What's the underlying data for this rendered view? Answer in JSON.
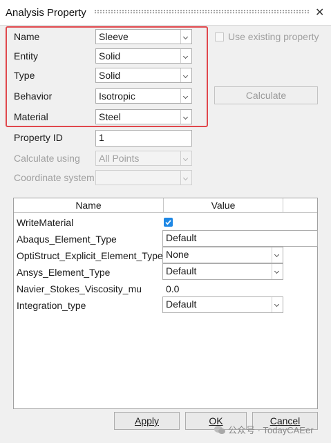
{
  "window": {
    "title": "Analysis Property",
    "close_glyph": "✕"
  },
  "form": {
    "name": {
      "label": "Name",
      "value": "Sleeve"
    },
    "entity": {
      "label": "Entity",
      "value": "Solid"
    },
    "type": {
      "label": "Type",
      "value": "Solid"
    },
    "behavior": {
      "label": "Behavior",
      "value": "Isotropic"
    },
    "material": {
      "label": "Material",
      "value": "Steel"
    },
    "property_id": {
      "label": "Property ID",
      "value": "1"
    },
    "calculate_using": {
      "label": "Calculate using",
      "value": "All Points"
    },
    "coordinate_system": {
      "label": "Coordinate system",
      "value": ""
    }
  },
  "use_existing": {
    "label": "Use existing property",
    "checked": false
  },
  "calculate_button": {
    "label": "Calculate"
  },
  "table": {
    "headers": {
      "name": "Name",
      "value": "Value"
    },
    "rows": [
      {
        "name": "WriteMaterial",
        "value": "",
        "kind": "checkbox",
        "checked": true
      },
      {
        "name": "Abaqus_Element_Type",
        "value": "Default",
        "kind": "text"
      },
      {
        "name": "OptiStruct_Explicit_Element_Type",
        "value": "None",
        "kind": "combo"
      },
      {
        "name": "Ansys_Element_Type",
        "value": "Default",
        "kind": "combo"
      },
      {
        "name": "Navier_Stokes_Viscosity_mu",
        "value": "0.0",
        "kind": "plain"
      },
      {
        "name": "Integration_type",
        "value": "Default",
        "kind": "combo"
      }
    ]
  },
  "buttons": {
    "apply": "Apply",
    "ok": "OK",
    "cancel": "Cancel"
  },
  "watermark": "公众号 · TodayCAEer",
  "colors": {
    "highlight": "#e0474c",
    "checkbox": "#1e88e5"
  }
}
